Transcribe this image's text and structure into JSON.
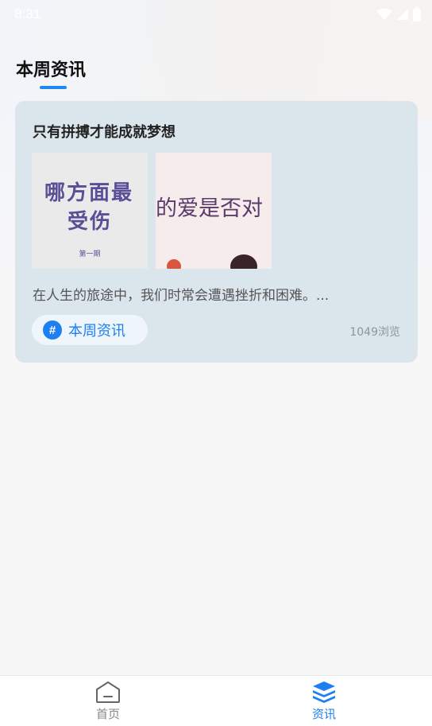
{
  "status_bar": {
    "time": "8:31"
  },
  "page": {
    "title": "本周资讯"
  },
  "article": {
    "title": "只有拼搏才能成就梦想",
    "images": [
      {
        "line1": "哪方面最",
        "line2": "受伤",
        "line3": "第一期"
      },
      {
        "line1": "的爱是否对"
      }
    ],
    "description": "在人生的旅途中，我们时常会遭遇挫折和困难。...",
    "tag": {
      "icon": "hashtag-icon",
      "label": "本周资讯"
    },
    "views": "1049浏览"
  },
  "bottom_nav": [
    {
      "label": "首页",
      "icon": "home-icon",
      "active": false
    },
    {
      "label": "资讯",
      "icon": "layers-icon",
      "active": true
    }
  ],
  "colors": {
    "accent": "#1e7ff0",
    "card_bg": "#dbe6ec"
  }
}
